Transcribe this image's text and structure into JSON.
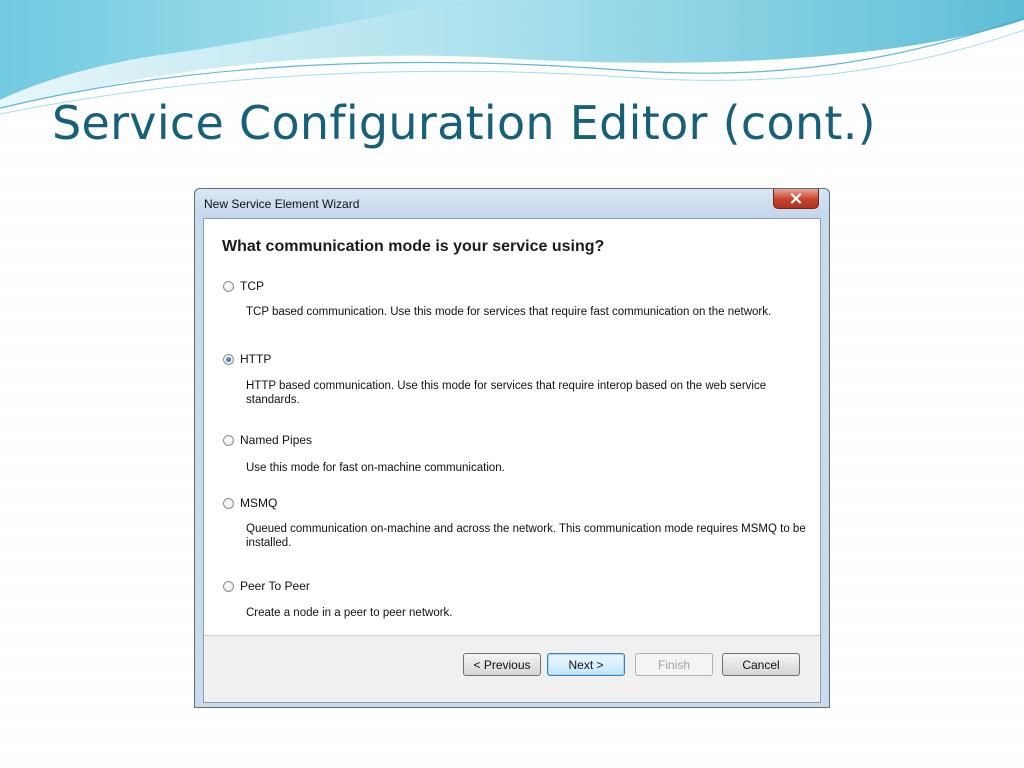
{
  "slide": {
    "title": "Service Configuration Editor (cont.)"
  },
  "window": {
    "title": "New Service Element Wizard",
    "close_symbol": "x"
  },
  "wizard": {
    "heading": "What communication mode is your service using?",
    "options": [
      {
        "label": "TCP",
        "checked": false,
        "description": "TCP based communication. Use this mode for services that require fast communication on the network."
      },
      {
        "label": "HTTP",
        "checked": true,
        "description": "HTTP based communication. Use this mode for services that require interop based on the web service standards."
      },
      {
        "label": "Named Pipes",
        "checked": false,
        "description": "Use this mode for fast on-machine communication."
      },
      {
        "label": "MSMQ",
        "checked": false,
        "description": "Queued communication on-machine and across the network. This communication mode requires MSMQ to be installed."
      },
      {
        "label": "Peer To Peer",
        "checked": false,
        "description": "Create a node in a peer to peer network."
      }
    ]
  },
  "buttons": {
    "previous": "< Previous",
    "next": "Next >",
    "finish": "Finish",
    "cancel": "Cancel"
  },
  "colors": {
    "title": "#17607a",
    "wave_light": "#bfe8f2",
    "wave_mid": "#5fc0d8",
    "close_button": "#c8432c"
  }
}
